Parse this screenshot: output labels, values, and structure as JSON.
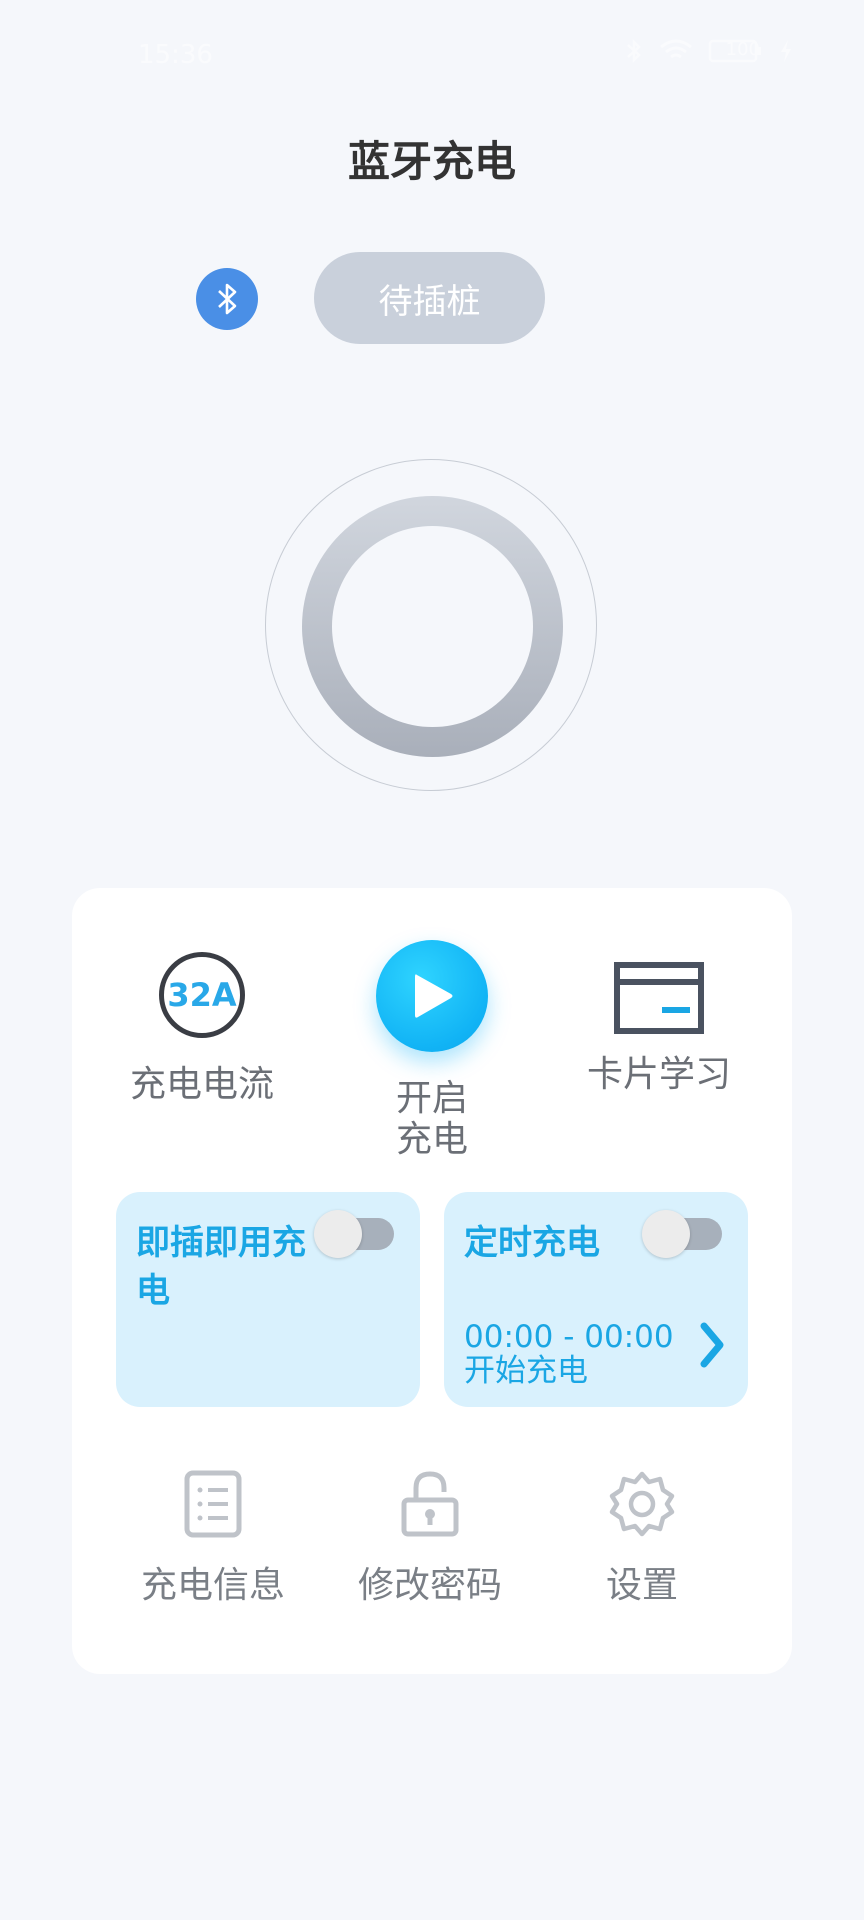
{
  "status_bar": {
    "time": "15:36",
    "battery": "100"
  },
  "header": {
    "title": "蓝牙充电"
  },
  "connection": {
    "status_label": "待插桩"
  },
  "actions": {
    "current": {
      "badge": "32A",
      "label": "充电电流"
    },
    "start": {
      "label_line1": "开启",
      "label_line2": "充电"
    },
    "card_learn": {
      "label": "卡片学习"
    }
  },
  "cards": {
    "plug_and_play": {
      "title": "即插即用充电",
      "enabled": false
    },
    "scheduled": {
      "title": "定时充电",
      "enabled": false,
      "time_range": "00:00 - 00:00",
      "sub_label": "开始充电"
    }
  },
  "bottom_menu": {
    "charge_info": "充电信息",
    "change_password": "修改密码",
    "settings": "设置"
  },
  "colors": {
    "accent": "#1aa6e4",
    "bluetooth": "#4a8fe6",
    "card_bg": "#d9f1fd"
  }
}
